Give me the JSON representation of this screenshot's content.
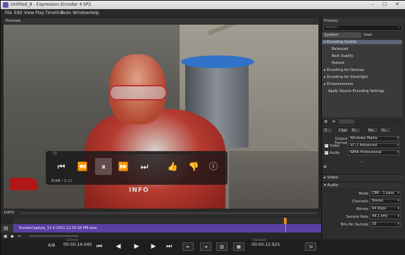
{
  "window": {
    "title": "Untitled_8 - Expression Encoder 4 SP2",
    "min": "–",
    "max": "☐",
    "close": "✕"
  },
  "menu": [
    "File",
    "Edit",
    "View",
    "Play",
    "Timeline",
    "Tools",
    "Window",
    "Help"
  ],
  "preview": {
    "header": "Preview",
    "info_label": "INFO"
  },
  "player": {
    "time_current": "0:04",
    "time_total": "/ 0:12"
  },
  "presets": {
    "header": "Presets",
    "search_placeholder": "Search",
    "tabs": [
      "System",
      "User"
    ],
    "tree": [
      {
        "label": "Encoding Quality",
        "indent": 1,
        "highlight": true,
        "expander": "▾"
      },
      {
        "label": "Balanced",
        "indent": 2
      },
      {
        "label": "Best Quality",
        "indent": 2
      },
      {
        "label": "Fastest",
        "indent": 2
      },
      {
        "label": "Encoding for Devices",
        "indent": 1,
        "expander": "▸"
      },
      {
        "label": "Encoding for Silverlight",
        "indent": 1,
        "expander": "▸"
      },
      {
        "label": "Enhancements",
        "indent": 1,
        "expander": "▸"
      },
      {
        "label": "Apply Source Encoding Settings",
        "indent": 1
      }
    ]
  },
  "encode_tabs": [
    "E...",
    "Clips",
    "En...",
    "Me...",
    "Ou..."
  ],
  "encode": {
    "output_format_label": "Output Format",
    "output_format": "Windows Media",
    "video_label": "Video",
    "video_codec": "VC-1 Advanced",
    "audio_label": "Audio",
    "audio_codec": "WMA Professional",
    "video_section": "Video",
    "audio_section": "Audio",
    "mode_label": "Mode",
    "mode": "CBR - 1 pass",
    "channels_label": "Channels",
    "channels": "Stereo",
    "bitrate_label": "Bitrate",
    "bitrate": "64 Kbps",
    "sample_rate_label": "Sample Rate",
    "sample_rate": "44.1 kHz",
    "bits_label": "Bits Per Sample",
    "bits": "16"
  },
  "timeline": {
    "zoom": "100%",
    "clip_name": "ScreenCapture_11-4-2011 12.55.56 PM.xesc",
    "ab_label": "A/B",
    "time_current": "00:00:14.040",
    "time_end": "00:00:15.925",
    "time_current_caption": "Current",
    "time_end_caption": "Duration"
  },
  "colors": {
    "accent": "#5b3fa4",
    "selection": "#5a6577"
  }
}
